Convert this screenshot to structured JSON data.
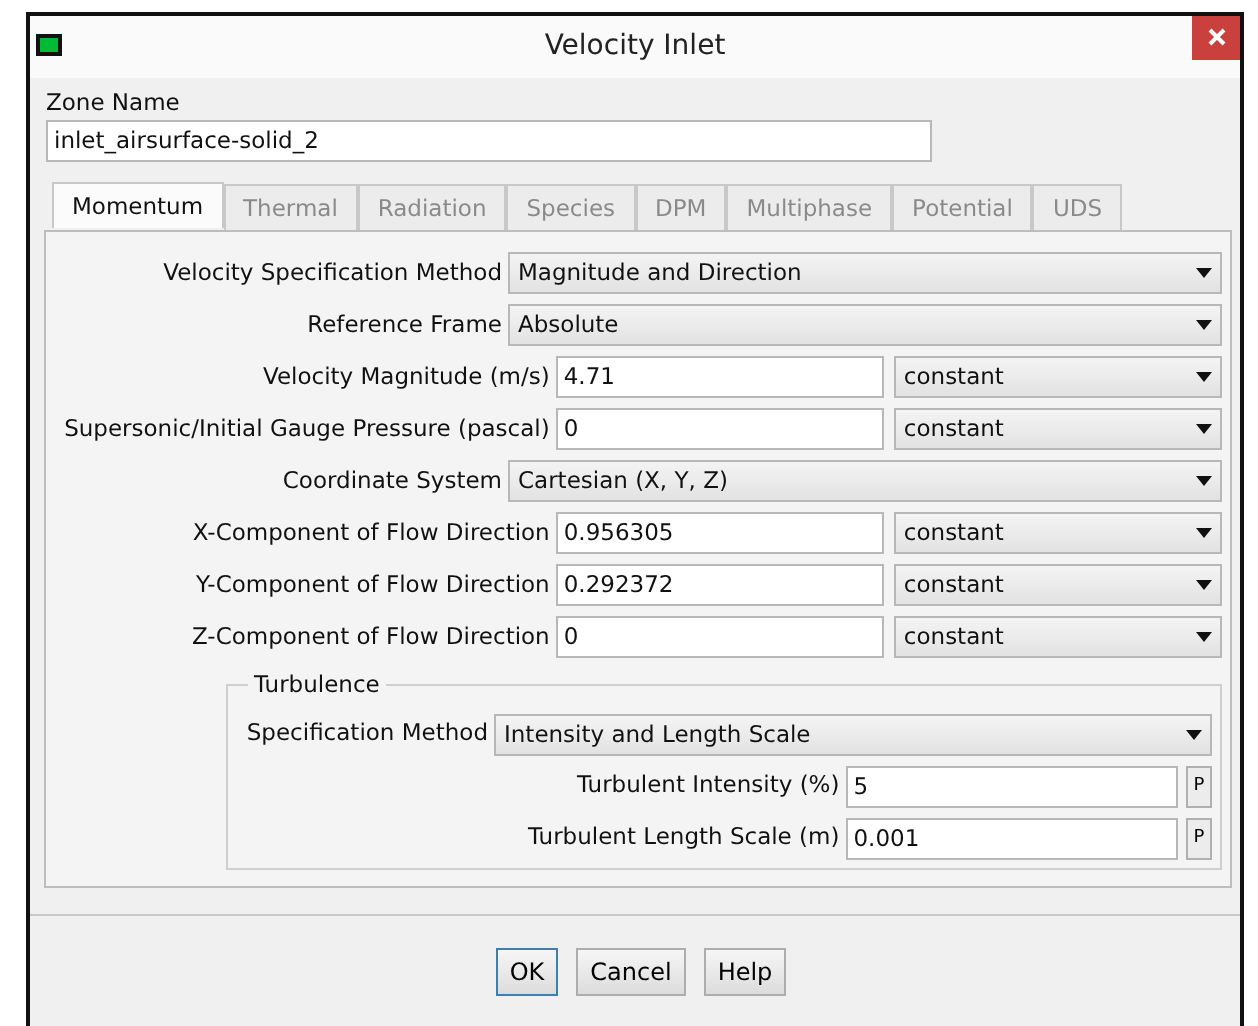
{
  "window": {
    "title": "Velocity Inlet"
  },
  "zone_name": {
    "label": "Zone Name",
    "value": "inlet_airsurface-solid_2"
  },
  "tabs": [
    {
      "label": "Momentum",
      "selected": true,
      "disabled": false
    },
    {
      "label": "Thermal",
      "selected": false,
      "disabled": true
    },
    {
      "label": "Radiation",
      "selected": false,
      "disabled": true
    },
    {
      "label": "Species",
      "selected": false,
      "disabled": true
    },
    {
      "label": "DPM",
      "selected": false,
      "disabled": true
    },
    {
      "label": "Multiphase",
      "selected": false,
      "disabled": true
    },
    {
      "label": "Potential",
      "selected": false,
      "disabled": true
    },
    {
      "label": "UDS",
      "selected": false,
      "disabled": true
    }
  ],
  "momentum_rows": [
    {
      "kind": "dropdown",
      "label": "Velocity Specification Method",
      "value": "Magnitude and Direction"
    },
    {
      "kind": "dropdown",
      "label": "Reference Frame",
      "value": "Absolute"
    },
    {
      "kind": "field",
      "label": "Velocity Magnitude (m/s)",
      "value": "4.71",
      "method": "constant"
    },
    {
      "kind": "field",
      "label": "Supersonic/Initial Gauge Pressure (pascal)",
      "value": "0",
      "method": "constant"
    },
    {
      "kind": "dropdown",
      "label": "Coordinate System",
      "value": "Cartesian (X, Y, Z)"
    },
    {
      "kind": "field",
      "label": "X-Component of Flow Direction",
      "value": "0.956305",
      "method": "constant"
    },
    {
      "kind": "field",
      "label": "Y-Component of Flow Direction",
      "value": "0.292372",
      "method": "constant"
    },
    {
      "kind": "field",
      "label": "Z-Component of Flow Direction",
      "value": "0",
      "method": "constant"
    }
  ],
  "turbulence": {
    "title": "Turbulence",
    "rows": [
      {
        "kind": "dropdown",
        "label": "Specification Method",
        "value": "Intensity and Length Scale"
      },
      {
        "kind": "param",
        "label": "Turbulent Intensity (%)",
        "value": "5",
        "button": "P"
      },
      {
        "kind": "param",
        "label": "Turbulent Length Scale (m)",
        "value": "0.001",
        "button": "P"
      }
    ]
  },
  "buttons": [
    {
      "label": "OK",
      "selected": true
    },
    {
      "label": "Cancel",
      "selected": false
    },
    {
      "label": "Help",
      "selected": false
    }
  ]
}
